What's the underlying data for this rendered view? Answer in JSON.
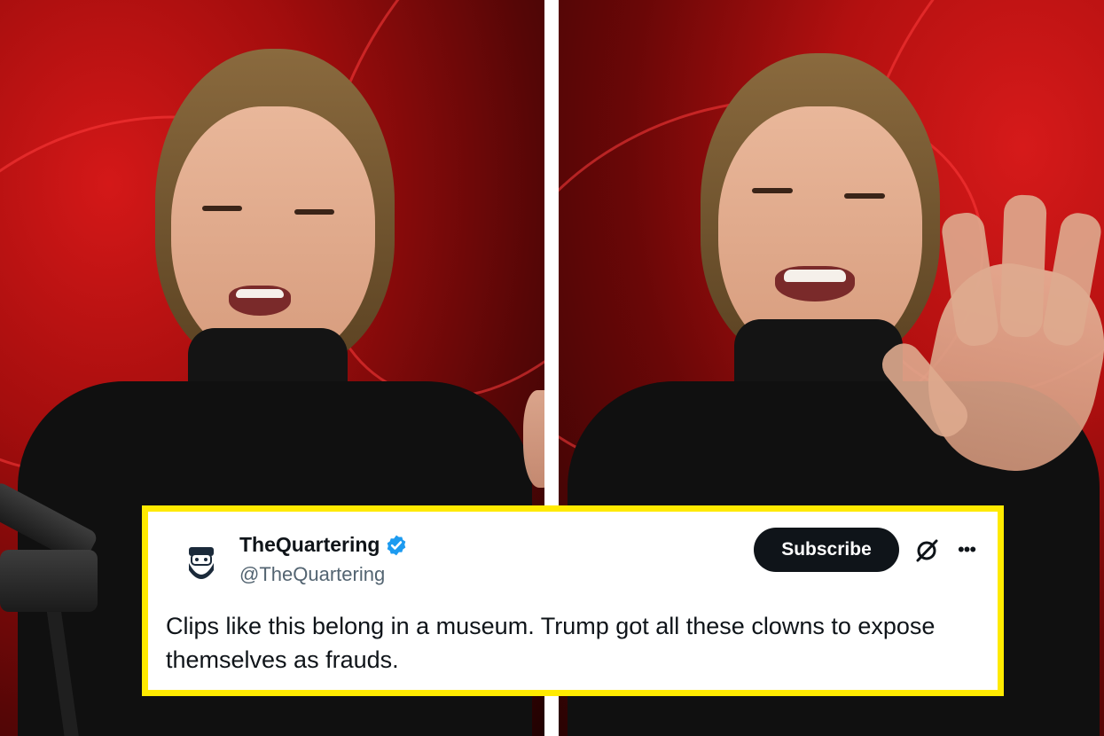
{
  "tweet": {
    "display_name": "TheQuartering",
    "handle": "@TheQuartering",
    "subscribe_label": "Subscribe",
    "text": "Clips like this belong in a museum. Trump got all these clowns to expose themselves as frauds.",
    "verified": true,
    "avatar_icon": "bearded-man-avatar-icon",
    "more_icon": "more-options-icon",
    "grok_icon": "grok-icon"
  },
  "colors": {
    "border_highlight": "#ffea00",
    "verified_blue": "#1d9bf0",
    "subscribe_bg": "#0f1419",
    "handle_gray": "#536471"
  }
}
